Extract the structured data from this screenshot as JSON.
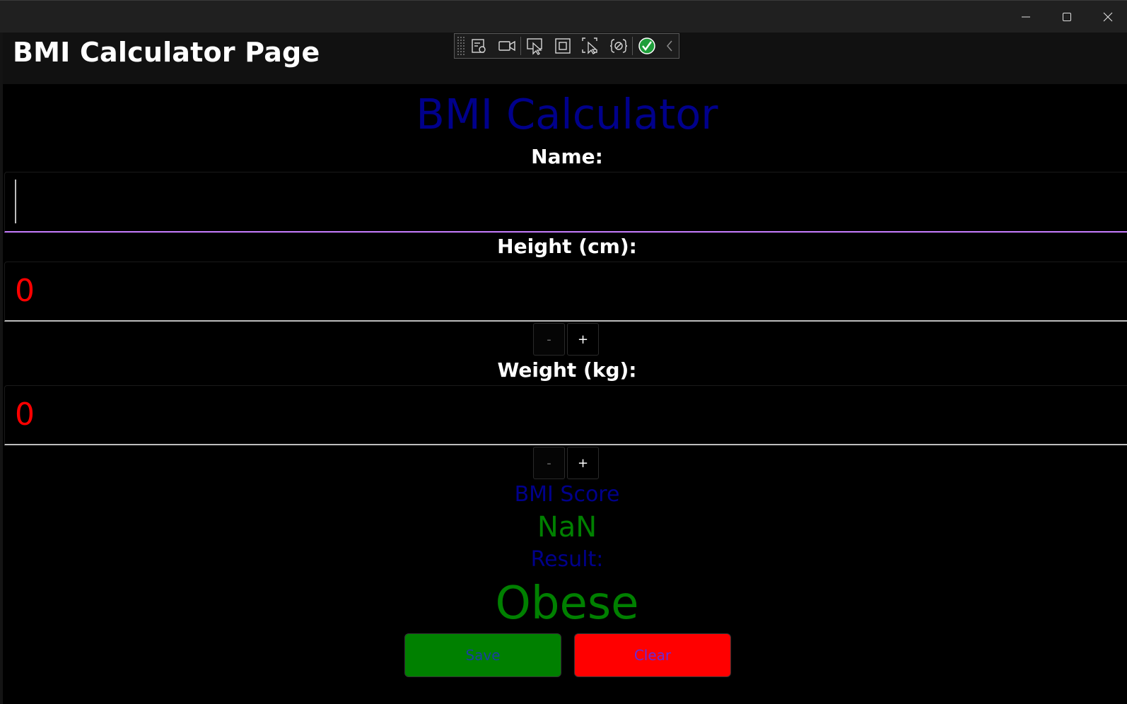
{
  "window": {
    "controls": [
      "minimize-icon",
      "maximize-icon",
      "close-icon"
    ]
  },
  "header": {
    "title": "BMI Calculator Page"
  },
  "debug_toolbar": {
    "icons": [
      "live-visual-tree-icon",
      "video-camera-icon",
      "select-element-icon",
      "display-layout-adorners-icon",
      "track-focus-icon",
      "binding-failures-icon",
      "xaml-hot-reload-ok-icon",
      "collapse-chevron-icon"
    ]
  },
  "main": {
    "heading": "BMI Calculator",
    "name_label": "Name:",
    "name_value": "",
    "height_label": "Height (cm):",
    "height_value": "0",
    "height_minus": "-",
    "height_plus": "+",
    "weight_label": "Weight (kg):",
    "weight_value": "0",
    "weight_minus": "-",
    "weight_plus": "+",
    "bmi_label": "BMI Score",
    "bmi_value": "NaN",
    "result_label": "Result:",
    "result_value": "Obese",
    "save_label": "Save",
    "clear_label": "Clear"
  },
  "colors": {
    "heading": "#00008b",
    "entry_value": "#ff0000",
    "score": "#008000",
    "save_bg": "#008000",
    "clear_bg": "#ff0000",
    "focus_underline": "#c77dff"
  }
}
